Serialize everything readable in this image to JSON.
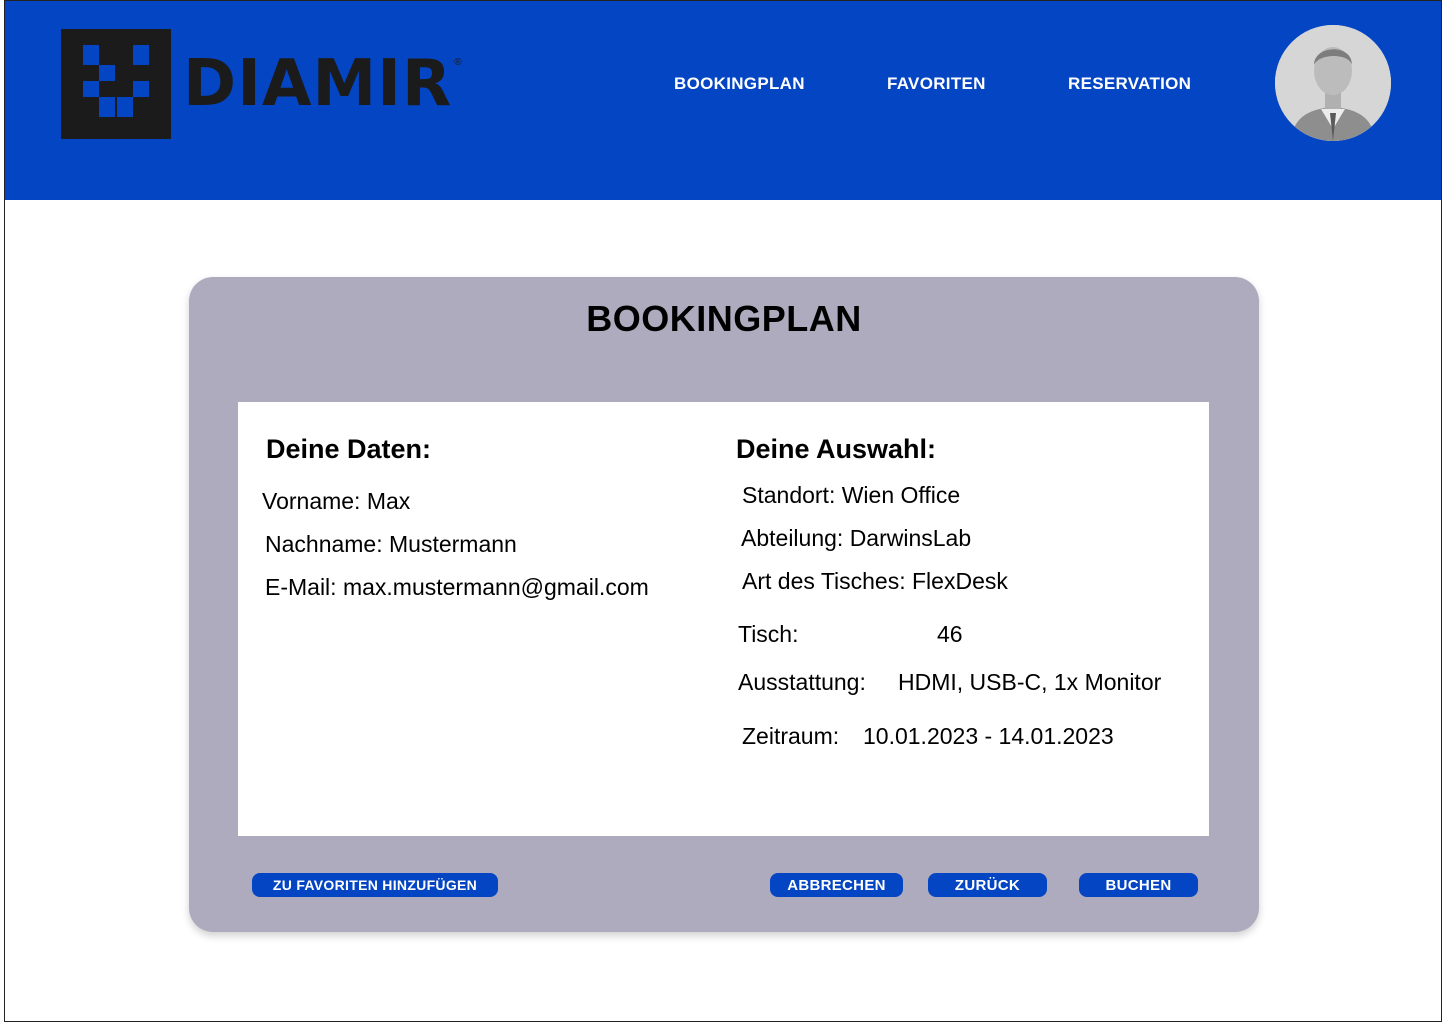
{
  "brand": {
    "name": "DIAMIR",
    "registered_mark": "®"
  },
  "nav": {
    "items": [
      {
        "label": "BOOKINGPLAN"
      },
      {
        "label": "FAVORITEN"
      },
      {
        "label": "RESERVATION"
      }
    ]
  },
  "page": {
    "title": "BOOKINGPLAN"
  },
  "user_data": {
    "heading": "Deine Daten:",
    "first_name": "Vorname: Max",
    "last_name": "Nachname: Mustermann",
    "email": "E-Mail: max.mustermann@gmail.com"
  },
  "selection": {
    "heading": "Deine Auswahl:",
    "location": "Standort: Wien Office",
    "department": "Abteilung: DarwinsLab",
    "desk_type": "Art des Tisches: FlexDesk",
    "desk_label": "Tisch:",
    "desk_value": "46",
    "equipment_label": "Ausstattung:",
    "equipment_value": "HDMI, USB-C, 1x Monitor",
    "period_label": "Zeitraum:",
    "period_value": "10.01.2023 - 14.01.2023"
  },
  "actions": {
    "add_favorite": "ZU FAVORITEN HINZUFÜGEN",
    "cancel": "ABBRECHEN",
    "back": "ZURÜCK",
    "book": "BUCHEN"
  },
  "colors": {
    "header_bg": "#0445c4",
    "card_bg": "#adabbd",
    "button_bg": "#0445c4"
  },
  "icons": {
    "logo": "diamir-logo-mark",
    "avatar": "user-avatar"
  }
}
